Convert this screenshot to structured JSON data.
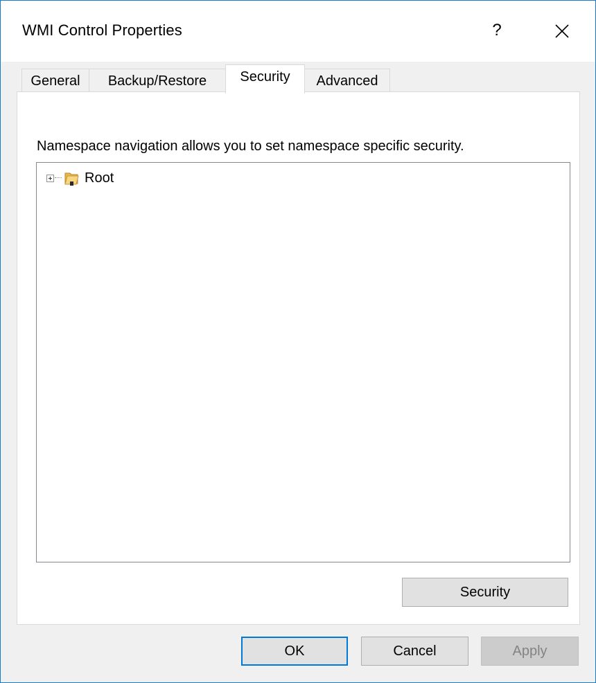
{
  "window": {
    "title": "WMI Control Properties",
    "help_label": "?",
    "close_icon": "close-icon"
  },
  "tabs": [
    {
      "label": "General",
      "selected": false
    },
    {
      "label": "Backup/Restore",
      "selected": false
    },
    {
      "label": "Security",
      "selected": true
    },
    {
      "label": "Advanced",
      "selected": false
    }
  ],
  "security_page": {
    "description": "Namespace navigation allows you to set namespace specific security.",
    "tree": {
      "nodes": [
        {
          "label": "Root",
          "icon": "folder-icon",
          "expanded": false
        }
      ]
    },
    "security_button_label": "Security"
  },
  "footer": {
    "ok_label": "OK",
    "cancel_label": "Cancel",
    "apply_label": "Apply"
  },
  "colors": {
    "window_border": "#1979ca",
    "default_button_border": "#0078d7",
    "dialog_background": "#f0f0f0"
  }
}
